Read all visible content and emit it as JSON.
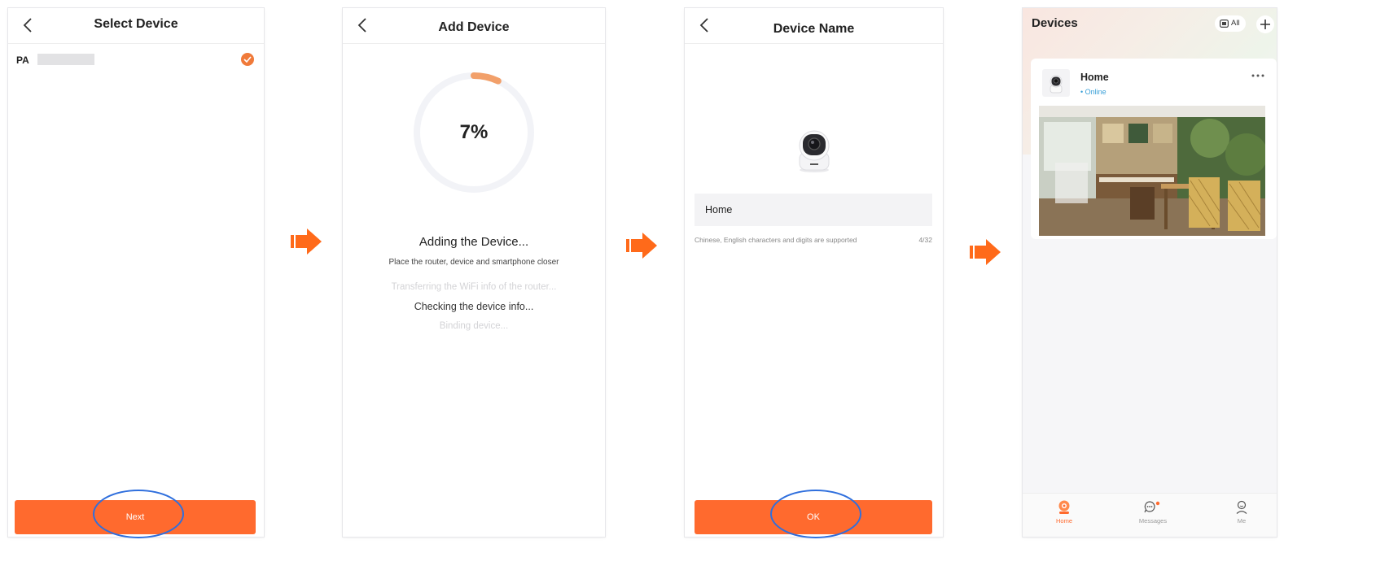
{
  "panel1": {
    "title": "Select Device",
    "device_name": "PA",
    "next_label": "Next"
  },
  "panel2": {
    "title": "Add Device",
    "progress_percent": 7,
    "progress_text": "7%",
    "adding_title": "Adding the Device...",
    "adding_subtitle": "Place the router, device and smartphone closer",
    "steps": [
      {
        "label": "Transferring the WiFi info of the router...",
        "state": "pending"
      },
      {
        "label": "Checking the device info...",
        "state": "active"
      },
      {
        "label": "Binding device...",
        "state": "pending"
      }
    ]
  },
  "panel3": {
    "title": "Device Name",
    "name_value": "Home",
    "hint": "Chinese, English characters and digits are supported",
    "counter": "4/32",
    "ok_label": "OK"
  },
  "panel4": {
    "title": "Devices",
    "filter_label": "All",
    "device": {
      "name": "Home",
      "status": "• Online"
    },
    "tabs": [
      {
        "label": "Home",
        "icon": "home-camera-icon",
        "active": true
      },
      {
        "label": "Messages",
        "icon": "messages-icon",
        "active": false,
        "badge": true
      },
      {
        "label": "Me",
        "icon": "person-icon",
        "active": false
      }
    ]
  },
  "colors": {
    "accent": "#ff6a2e",
    "arrow": "#ff6a1a",
    "highlight_ring": "#2f6fdd",
    "online": "#3aa0d8",
    "progress_track": "#f2f3f7"
  }
}
